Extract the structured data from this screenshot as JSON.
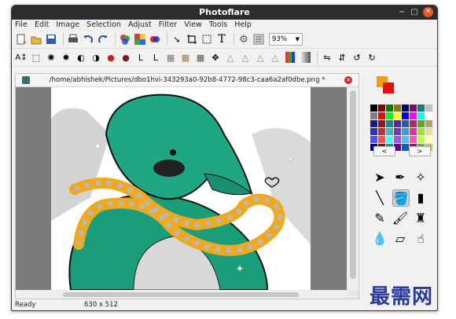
{
  "window": {
    "title": "Photoflare",
    "minimize": "−",
    "maximize": "□",
    "close": "✕"
  },
  "menubar": {
    "items": [
      "File",
      "Edit",
      "Image",
      "Selection",
      "Adjust",
      "Filter",
      "View",
      "Tools",
      "Help"
    ]
  },
  "toolbar1": {
    "zoom": "93%"
  },
  "document": {
    "tab_title": "/home/abhishek/Pictures/dbo1hvi-343293a0-92b8-4772-98c3-caa6a2af0dbe.png *",
    "close_icon": "close-red-icon"
  },
  "colors": {
    "primary": "#f5a000",
    "secondary": "#e01010"
  },
  "palette": [
    "#000000",
    "#800000",
    "#008000",
    "#808000",
    "#000080",
    "#800080",
    "#008080",
    "#c0c0c0",
    "#808080",
    "#ff0000",
    "#00ff00",
    "#ffff00",
    "#0000ff",
    "#ff00ff",
    "#00ffff",
    "#ffffff",
    "#1a1a8a",
    "#8a1a1a",
    "#1a8a8a",
    "#5a2a8a",
    "#2a5aaa",
    "#aa2a5a",
    "#5aaa2a",
    "#aaaa5a",
    "#3030c0",
    "#c03030",
    "#30c0c0",
    "#7a30c0",
    "#30a0e0",
    "#e030a0",
    "#a0e030",
    "#e0e0a0",
    "#5050ff",
    "#ff5050",
    "#50ffff",
    "#a050ff",
    "#50c0ff",
    "#ff50c0",
    "#c0ff50",
    "#ffffc0",
    "#0000a0",
    "#a00000",
    "#00a0a0",
    "#6000a0",
    "#0060c0",
    "#c00060",
    "#60c000",
    "#c0c060"
  ],
  "nav": {
    "prev": "<",
    "next": ">"
  },
  "status": {
    "text": "Ready",
    "dimensions": "630 x 512"
  },
  "watermark": "最需网"
}
